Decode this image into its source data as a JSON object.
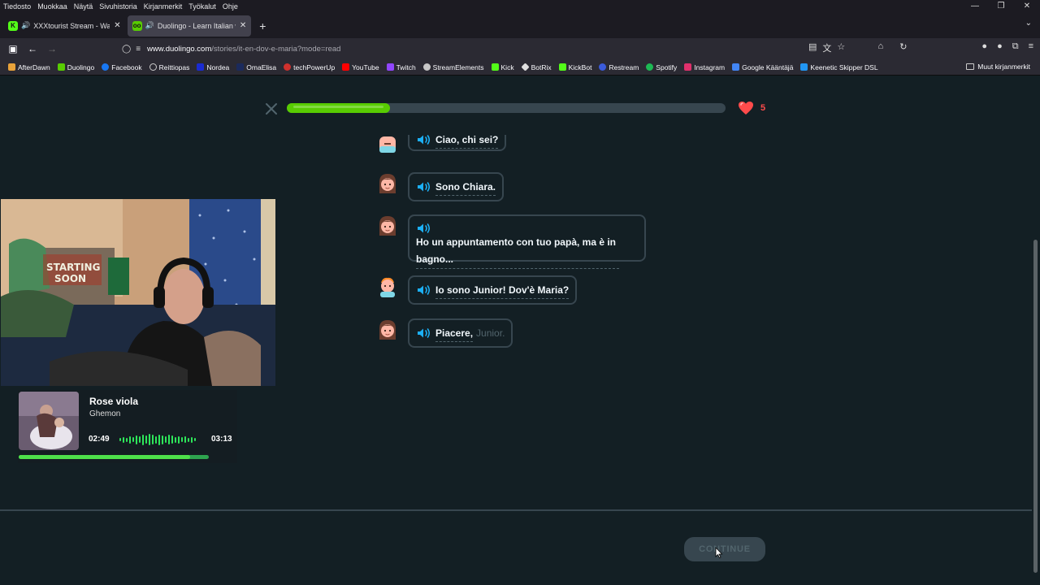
{
  "menubar": {
    "items": [
      "Tiedosto",
      "Muokkaa",
      "Näytä",
      "Sivuhistoria",
      "Kirjanmerkit",
      "Työkalut",
      "Ohje"
    ]
  },
  "tabs": [
    {
      "title": "XXXtourist Stream - Watch",
      "favicon_color": "#53fc18",
      "favicon_letter": "K",
      "active": false
    },
    {
      "title": "Duolingo - Learn Italian with",
      "favicon_color": "#58cc02",
      "favicon_letter": "oo",
      "active": true
    }
  ],
  "navbar": {
    "url_host": "www.duolingo.com",
    "url_path": "/stories/it-en-dov-e-maria?mode=read"
  },
  "bookmarks": [
    {
      "label": "AfterDawn",
      "color": "#e8a23a"
    },
    {
      "label": "Duolingo",
      "color": "#58cc02"
    },
    {
      "label": "Facebook",
      "color": "#1877f2"
    },
    {
      "label": "Reittiopas",
      "color": "#cccccc"
    },
    {
      "label": "Nordea",
      "color": "#1a2bd1"
    },
    {
      "label": "OmaElisa",
      "color": "#1b2a5c"
    },
    {
      "label": "techPowerUp",
      "color": "#d0312d"
    },
    {
      "label": "YouTube",
      "color": "#ff0000"
    },
    {
      "label": "Twitch",
      "color": "#9146ff"
    },
    {
      "label": "StreamElements",
      "color": "#c7c7c7"
    },
    {
      "label": "Kick",
      "color": "#53fc18"
    },
    {
      "label": "BotRix",
      "color": "#e0e0e0"
    },
    {
      "label": "KickBot",
      "color": "#53fc18"
    },
    {
      "label": "Restream",
      "color": "#3b5bdb"
    },
    {
      "label": "Spotify",
      "color": "#1db954"
    },
    {
      "label": "Instagram",
      "color": "#e1306c"
    },
    {
      "label": "Google Kääntäjä",
      "color": "#4285f4"
    },
    {
      "label": "Keenetic Skipper DSL",
      "color": "#2196f3"
    }
  ],
  "other_bookmarks": "Muut kirjanmerkit",
  "lesson": {
    "progress": 0.235,
    "hearts": "5",
    "lines": [
      {
        "text": "Ciao, chi sei?",
        "dim": "",
        "speaker": "junior"
      },
      {
        "text": "Sono Chiara.",
        "dim": "",
        "speaker": "chiara"
      },
      {
        "text": "Ho un appuntamento con tuo papà, ma è in bagno...",
        "dim": "",
        "speaker": "chiara"
      },
      {
        "text": "Io sono Junior! Dov'è Maria?",
        "dim": "",
        "speaker": "junior"
      },
      {
        "text": "Piacere,",
        "dim": "Junior.",
        "speaker": "chiara"
      }
    ],
    "continue_label": "CONTINUE"
  },
  "now_playing": {
    "title": "Rose viola",
    "artist": "Ghemon",
    "elapsed": "02:49",
    "total": "03:13",
    "progress": 0.9
  },
  "colors": {
    "page_bg": "#131f24",
    "progress_green": "#58cc02",
    "heart_red": "#ff4b4b",
    "border": "#37464f",
    "speaker_blue": "#1cb0f6"
  }
}
